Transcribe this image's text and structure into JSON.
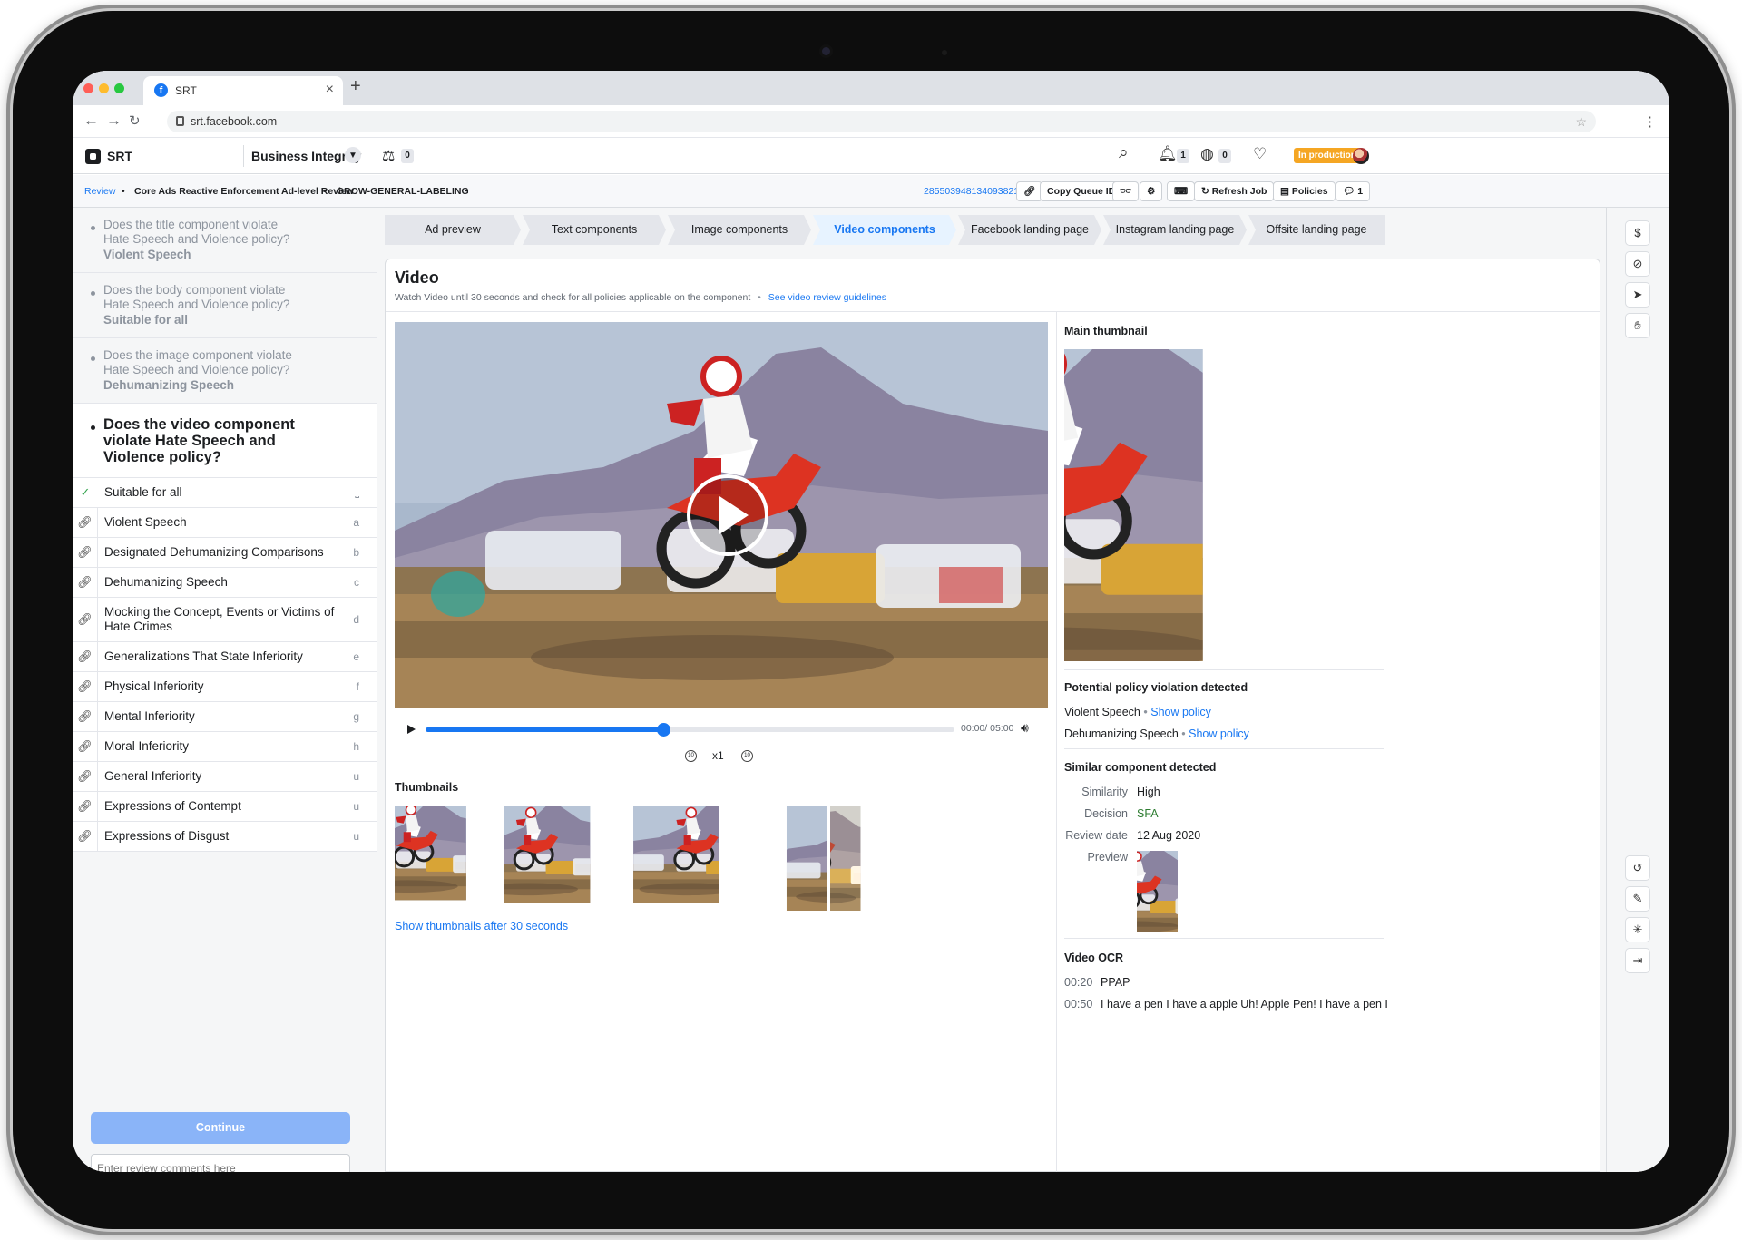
{
  "browser": {
    "tab_title": "SRT",
    "tab_close": "×",
    "new_tab": "+",
    "url": "srt.facebook.com",
    "nav": {
      "back": "←",
      "forward": "→",
      "reload": "↻"
    }
  },
  "header": {
    "app_name": "SRT",
    "workspace": "Business Integrity",
    "scale_count": "0",
    "notifications_count": "1",
    "globe_count": "0",
    "status_badge": "In production"
  },
  "breadcrumbs": {
    "review": "Review",
    "sep": "•",
    "queue": "Core Ads Reactive Enforcement Ad-level Review",
    "label": "GROW-GENERAL-LABELING",
    "job_id": "285503948134093821",
    "copy_queue": "Copy Queue ID",
    "refresh": "Refresh Job",
    "policies": "Policies",
    "comments_count": "1"
  },
  "questions": [
    {
      "text": "Does the title component violate Hate Speech and Violence policy?",
      "answer": "Violent Speech"
    },
    {
      "text": "Does the body component violate Hate Speech and Violence policy?",
      "answer": "Suitable for all"
    },
    {
      "text": "Does the image component violate Hate Speech and Violence policy?",
      "answer": "Dehumanizing Speech"
    }
  ],
  "current_question": "Does the video component violate Hate Speech and Violence policy?",
  "options": [
    {
      "label": "Suitable for all",
      "key": "⎵",
      "icon": "check-icon"
    },
    {
      "label": "Violent Speech",
      "key": "a",
      "icon": "link-icon"
    },
    {
      "label": "Designated Dehumanizing Comparisons",
      "key": "b",
      "icon": "link-icon"
    },
    {
      "label": "Dehumanizing Speech",
      "key": "c",
      "icon": "link-icon"
    },
    {
      "label": "Mocking the Concept, Events or Victims of Hate Crimes",
      "key": "d",
      "icon": "link-icon"
    },
    {
      "label": "Generalizations That State Inferiority",
      "key": "e",
      "icon": "link-icon"
    },
    {
      "label": "Physical Inferiority",
      "key": "f",
      "icon": "link-icon"
    },
    {
      "label": "Mental Inferiority",
      "key": "g",
      "icon": "link-icon"
    },
    {
      "label": "Moral Inferiority",
      "key": "h",
      "icon": "link-icon"
    },
    {
      "label": "General Inferiority",
      "key": "u",
      "icon": "link-icon"
    },
    {
      "label": "Expressions of Contempt",
      "key": "u",
      "icon": "link-icon"
    },
    {
      "label": "Expressions of Disgust",
      "key": "u",
      "icon": "link-icon"
    }
  ],
  "continue_label": "Continue",
  "comments_placeholder": "Enter review comments here",
  "tabs": [
    {
      "label": "Ad preview",
      "active": false
    },
    {
      "label": "Text components",
      "active": false
    },
    {
      "label": "Image components",
      "active": false
    },
    {
      "label": "Video components",
      "active": true
    },
    {
      "label": "Facebook landing page",
      "active": false
    },
    {
      "label": "Instagram landing page",
      "active": false
    },
    {
      "label": "Offsite landing page",
      "active": false
    }
  ],
  "video": {
    "title": "Video",
    "subtitle": "Watch Video until 30 seconds and check for all policies applicable on the component",
    "sep": "•",
    "guidelines_link": "See video review guidelines",
    "time": "00:00/ 05:00",
    "progress": 0.45,
    "speed": "x1",
    "thumbnails_label": "Thumbnails",
    "show_thumbnails": "Show thumbnails after 30 seconds"
  },
  "side": {
    "main_thumbnail": "Main thumbnail",
    "violation_title": "Potential policy violation detected",
    "violations": [
      {
        "name": "Violent Speech",
        "link": "Show policy"
      },
      {
        "name": "Dehumanizing Speech",
        "link": "Show policy"
      }
    ],
    "dot": "•",
    "similar_title": "Similar component detected",
    "similarity_label": "Similarity",
    "similarity_value": "High",
    "decision_label": "Decision",
    "decision_value": "SFA",
    "review_date_label": "Review date",
    "review_date_value": "12 Aug 2020",
    "preview_label": "Preview",
    "ocr_title": "Video OCR",
    "ocr_time": "00:20",
    "ocr_text": "PPAP",
    "ocr_time2": "00:50",
    "ocr_text2": "I have a pen I have a apple Uh! Apple Pen! I have a pen I"
  },
  "colors": {
    "accent": "#1877f2",
    "badge": "#f5a623",
    "decision": "#2e7d32"
  },
  "rail_icons": [
    "dollar-icon",
    "no-symbol-icon",
    "send-icon",
    "hand-icon",
    "history-icon",
    "pen-icon",
    "bug-icon",
    "exit-icon"
  ]
}
